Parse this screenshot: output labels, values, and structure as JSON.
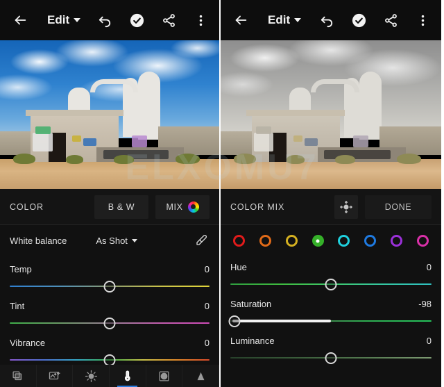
{
  "toolbar": {
    "back_icon": "arrow-left-icon",
    "title": "Edit",
    "dropdown_icon": "chevron-down-icon",
    "undo_icon": "undo-icon",
    "check_icon": "check-circle-icon",
    "share_icon": "share-icon",
    "overflow_icon": "more-vertical-icon"
  },
  "left_panel": {
    "section": {
      "title": "COLOR",
      "bw_label": "B & W",
      "mix_label": "MIX",
      "mix_icon": "color-wheel-icon"
    },
    "white_balance": {
      "label": "White balance",
      "value": "As Shot",
      "picker_icon": "eyedropper-icon"
    },
    "sliders": [
      {
        "name": "Temp",
        "value": "0",
        "knob_pct": 50,
        "track": "t-temp"
      },
      {
        "name": "Tint",
        "value": "0",
        "knob_pct": 50,
        "track": "t-tint"
      },
      {
        "name": "Vibrance",
        "value": "0",
        "knob_pct": 50,
        "track": "t-vib"
      }
    ]
  },
  "right_panel": {
    "section": {
      "title": "COLOR MIX",
      "target_icon": "targeted-adjustment-icon",
      "done_label": "DONE"
    },
    "swatches": [
      {
        "name": "red",
        "color": "#e01b1b",
        "selected": false
      },
      {
        "name": "orange",
        "color": "#e06a18",
        "selected": false
      },
      {
        "name": "yellow",
        "color": "#d4b021",
        "selected": false
      },
      {
        "name": "green",
        "color": "#35b029",
        "selected": true
      },
      {
        "name": "aqua",
        "color": "#1fd0dd",
        "selected": false
      },
      {
        "name": "blue",
        "color": "#1f7ae0",
        "selected": false
      },
      {
        "name": "purple",
        "color": "#9b30d9",
        "selected": false
      },
      {
        "name": "magenta",
        "color": "#d930a8",
        "selected": false
      }
    ],
    "sliders": [
      {
        "name": "Hue",
        "value": "0",
        "knob_pct": 50,
        "track": "t-hue",
        "fill": false
      },
      {
        "name": "Saturation",
        "value": "-98",
        "knob_pct": 1,
        "track": "t-sat",
        "fill": true,
        "fill_pct": 50
      },
      {
        "name": "Luminance",
        "value": "0",
        "knob_pct": 50,
        "track": "t-lum",
        "fill": false
      }
    ]
  },
  "tabbar": {
    "tabs": [
      {
        "icon": "layers-icon",
        "active": false
      },
      {
        "icon": "presets-image-icon",
        "active": false
      },
      {
        "icon": "light-sun-icon",
        "active": false
      },
      {
        "icon": "color-thermometer-icon",
        "active": true
      },
      {
        "icon": "effects-circle-icon",
        "active": false
      },
      {
        "icon": "detail-triangle-icon",
        "active": false
      }
    ]
  },
  "watermark": {
    "text": "ELXOMU7"
  }
}
